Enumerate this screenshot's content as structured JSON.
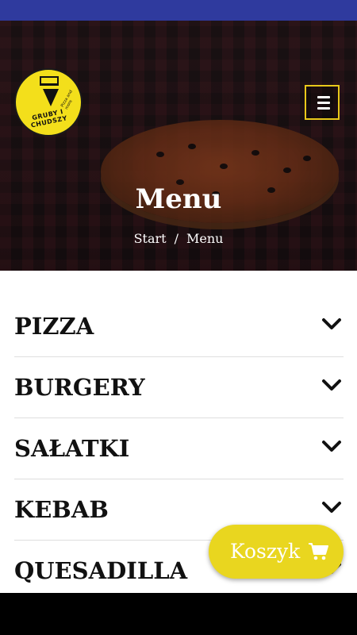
{
  "colors": {
    "status_bar": "#2f3a9e",
    "accent": "#e9d61f",
    "menu_border": "#e8c81a"
  },
  "logo": {
    "text": "GRUBY I CHUDSZY",
    "subtext": "Pizza and more"
  },
  "header": {
    "title": "Menu",
    "breadcrumb": {
      "home": "Start",
      "separator": "/",
      "current": "Menu"
    }
  },
  "menu_icon": "hamburger-icon",
  "categories": [
    {
      "label": "PIZZA"
    },
    {
      "label": "BURGERY"
    },
    {
      "label": "SAŁATKI"
    },
    {
      "label": "KEBAB"
    },
    {
      "label": "QUESADILLA"
    }
  ],
  "cart": {
    "label": "Koszyk",
    "icon": "shopping-cart-icon"
  }
}
